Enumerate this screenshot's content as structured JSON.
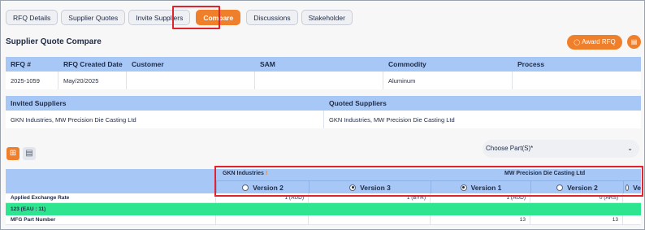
{
  "tabs": [
    {
      "label": "RFQ Details"
    },
    {
      "label": "Supplier Quotes"
    },
    {
      "label": "Invite Suppliers"
    },
    {
      "label": "Compare"
    },
    {
      "label": "Discussions"
    },
    {
      "label": "Stakeholder"
    }
  ],
  "page_title": "Supplier Quote Compare",
  "actions": {
    "award_label": "Award RFQ",
    "award_icon": "trophy-icon",
    "doc_icon": "document-icon"
  },
  "rfq_table": {
    "headers": [
      "RFQ #",
      "RFQ Created Date",
      "Customer",
      "SAM",
      "Commodity",
      "Process"
    ],
    "values": [
      "2025-1059",
      "May/20/2025",
      "",
      "",
      "Aluminum",
      ""
    ]
  },
  "suppliers_table": {
    "headers": [
      "Invited Suppliers",
      "Quoted Suppliers"
    ],
    "values": [
      "GKN Industries, MW Precision Die Casting Ltd",
      "GKN Industries, MW Precision Die Casting Ltd"
    ]
  },
  "view_toggle": {
    "active": "grid"
  },
  "part_select": {
    "placeholder": "Choose Part(S)*"
  },
  "compare": {
    "suppliers": [
      {
        "name": "GKN Industries",
        "flag": "!"
      },
      {
        "name": "MW Precision Die Casting Ltd"
      }
    ],
    "versions": [
      {
        "label": "Version 2",
        "selected": false
      },
      {
        "label": "Version 3",
        "selected": true
      },
      {
        "label": "Version 1",
        "selected": true
      },
      {
        "label": "Version 2",
        "selected": false
      },
      {
        "label": "Ve",
        "selected": false
      }
    ],
    "exchange_row": {
      "label": "Applied Exchange Rate",
      "values": [
        "1 (AUD)",
        "1 (BYR)",
        "1 (AUD)",
        "0 (ARS)"
      ]
    },
    "part_row": {
      "label": "123 (EAU : 11)"
    },
    "mfg_row": {
      "label": "MFG Part Number",
      "values": [
        "",
        "",
        "13",
        "13"
      ]
    }
  },
  "colors": {
    "accent": "#f07f2b",
    "header_blue": "#a7c8f6",
    "part_green": "#2ee58f",
    "highlight_red": "#e0242f"
  }
}
